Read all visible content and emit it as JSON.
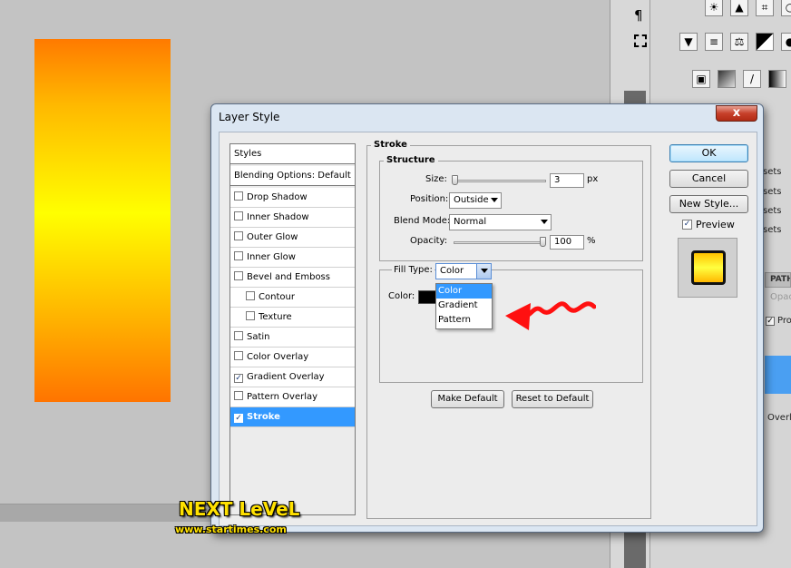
{
  "dialog": {
    "title": "Layer Style",
    "close_glyph": "x"
  },
  "styles_list": {
    "header": "Styles",
    "blending": "Blending Options: Default",
    "items": [
      {
        "label": "Drop Shadow",
        "checked": false
      },
      {
        "label": "Inner Shadow",
        "checked": false
      },
      {
        "label": "Outer Glow",
        "checked": false
      },
      {
        "label": "Inner Glow",
        "checked": false
      },
      {
        "label": "Bevel and Emboss",
        "checked": false
      },
      {
        "label": "Contour",
        "checked": false
      },
      {
        "label": "Texture",
        "checked": false
      },
      {
        "label": "Satin",
        "checked": false
      },
      {
        "label": "Color Overlay",
        "checked": false
      },
      {
        "label": "Gradient Overlay",
        "checked": true
      },
      {
        "label": "Pattern Overlay",
        "checked": false
      },
      {
        "label": "Stroke",
        "checked": true
      }
    ],
    "check_glyph": "✓"
  },
  "stroke": {
    "group_title": "Stroke",
    "structure_title": "Structure",
    "size_label": "Size:",
    "size_value": "3",
    "size_unit": "px",
    "position_label": "Position:",
    "position_value": "Outside",
    "blend_mode_label": "Blend Mode:",
    "blend_mode_value": "Normal",
    "opacity_label": "Opacity:",
    "opacity_value": "100",
    "opacity_unit": "%",
    "fill_type_label": "Fill Type:",
    "fill_type_value": "Color",
    "fill_type_options": [
      "Color",
      "Gradient",
      "Pattern"
    ],
    "color_label": "Color:",
    "stroke_color": "#000000",
    "make_default": "Make Default",
    "reset_default": "Reset to Default"
  },
  "buttons": {
    "ok": "OK",
    "cancel": "Cancel",
    "new_style": "New Style...",
    "preview_label": "Preview",
    "preview_checked": true
  },
  "side_panel": {
    "pilcrow": "¶",
    "presets_1": "sets",
    "presets_2": "sets",
    "presets_3": "sets",
    "presets_4": "sets",
    "paths_tab": "PATH",
    "opacity_short": "Opac",
    "pro_short": "Pro",
    "overlay_short": "Overla"
  },
  "watermark": {
    "title": "NEXT LeVeL",
    "url": "www.startimes.com"
  },
  "colors": {
    "arrow_red": "#ff1010",
    "selection_blue": "#3399ff"
  }
}
